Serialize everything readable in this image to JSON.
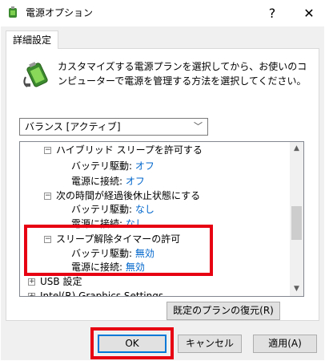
{
  "window": {
    "title": "電源オプション",
    "help_label": "?",
    "close_label": "✕"
  },
  "tab": {
    "label": "詳細設定"
  },
  "description": "カスタマイズする電源プランを選択してから、お使いのコンピューターで電源を管理する方法を選択してください。",
  "plan_select": {
    "value": "バランス [アクティブ]"
  },
  "tree": {
    "items": [
      {
        "label": "ハイブリッド スリープを許可する",
        "expander": "⊟"
      },
      {
        "label": "バッテリ駆動:",
        "value": "オフ"
      },
      {
        "label": "電源に接続:",
        "value": "オフ"
      },
      {
        "label": "次の時間が経過後休止状態にする",
        "expander": "⊟"
      },
      {
        "label": "バッテリ駆動:",
        "value": "なし"
      },
      {
        "label": "電源に接続:",
        "value": "なし"
      },
      {
        "label": "スリープ解除タイマーの許可",
        "expander": "⊟"
      },
      {
        "label": "バッテリ駆動:",
        "value": "無効"
      },
      {
        "label": "電源に接続:",
        "value": "無効"
      },
      {
        "label": "USB 設定",
        "expander": "⊞"
      },
      {
        "label": "Intel(R) Graphics Settings",
        "expander": "⊞"
      }
    ]
  },
  "buttons": {
    "restore": "既定のプランの復元(R)",
    "ok": "OK",
    "cancel": "キャンセル",
    "apply": "適用(A)"
  },
  "colors": {
    "highlight": "#e60012",
    "link": "#0066cc",
    "ok_border": "#0078d7"
  }
}
